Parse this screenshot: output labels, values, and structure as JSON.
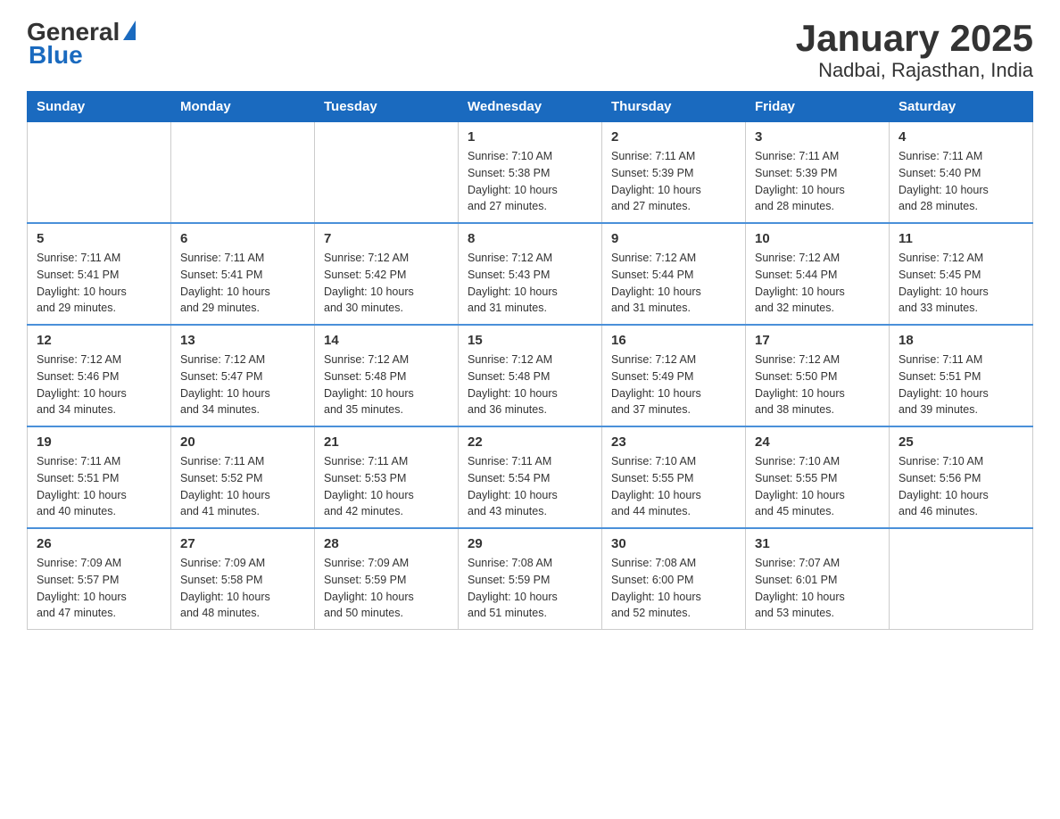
{
  "header": {
    "logo_general": "General",
    "logo_blue": "Blue",
    "title": "January 2025",
    "subtitle": "Nadbai, Rajasthan, India"
  },
  "days_of_week": [
    "Sunday",
    "Monday",
    "Tuesday",
    "Wednesday",
    "Thursday",
    "Friday",
    "Saturday"
  ],
  "weeks": [
    [
      {
        "day": "",
        "info": ""
      },
      {
        "day": "",
        "info": ""
      },
      {
        "day": "",
        "info": ""
      },
      {
        "day": "1",
        "info": "Sunrise: 7:10 AM\nSunset: 5:38 PM\nDaylight: 10 hours\nand 27 minutes."
      },
      {
        "day": "2",
        "info": "Sunrise: 7:11 AM\nSunset: 5:39 PM\nDaylight: 10 hours\nand 27 minutes."
      },
      {
        "day": "3",
        "info": "Sunrise: 7:11 AM\nSunset: 5:39 PM\nDaylight: 10 hours\nand 28 minutes."
      },
      {
        "day": "4",
        "info": "Sunrise: 7:11 AM\nSunset: 5:40 PM\nDaylight: 10 hours\nand 28 minutes."
      }
    ],
    [
      {
        "day": "5",
        "info": "Sunrise: 7:11 AM\nSunset: 5:41 PM\nDaylight: 10 hours\nand 29 minutes."
      },
      {
        "day": "6",
        "info": "Sunrise: 7:11 AM\nSunset: 5:41 PM\nDaylight: 10 hours\nand 29 minutes."
      },
      {
        "day": "7",
        "info": "Sunrise: 7:12 AM\nSunset: 5:42 PM\nDaylight: 10 hours\nand 30 minutes."
      },
      {
        "day": "8",
        "info": "Sunrise: 7:12 AM\nSunset: 5:43 PM\nDaylight: 10 hours\nand 31 minutes."
      },
      {
        "day": "9",
        "info": "Sunrise: 7:12 AM\nSunset: 5:44 PM\nDaylight: 10 hours\nand 31 minutes."
      },
      {
        "day": "10",
        "info": "Sunrise: 7:12 AM\nSunset: 5:44 PM\nDaylight: 10 hours\nand 32 minutes."
      },
      {
        "day": "11",
        "info": "Sunrise: 7:12 AM\nSunset: 5:45 PM\nDaylight: 10 hours\nand 33 minutes."
      }
    ],
    [
      {
        "day": "12",
        "info": "Sunrise: 7:12 AM\nSunset: 5:46 PM\nDaylight: 10 hours\nand 34 minutes."
      },
      {
        "day": "13",
        "info": "Sunrise: 7:12 AM\nSunset: 5:47 PM\nDaylight: 10 hours\nand 34 minutes."
      },
      {
        "day": "14",
        "info": "Sunrise: 7:12 AM\nSunset: 5:48 PM\nDaylight: 10 hours\nand 35 minutes."
      },
      {
        "day": "15",
        "info": "Sunrise: 7:12 AM\nSunset: 5:48 PM\nDaylight: 10 hours\nand 36 minutes."
      },
      {
        "day": "16",
        "info": "Sunrise: 7:12 AM\nSunset: 5:49 PM\nDaylight: 10 hours\nand 37 minutes."
      },
      {
        "day": "17",
        "info": "Sunrise: 7:12 AM\nSunset: 5:50 PM\nDaylight: 10 hours\nand 38 minutes."
      },
      {
        "day": "18",
        "info": "Sunrise: 7:11 AM\nSunset: 5:51 PM\nDaylight: 10 hours\nand 39 minutes."
      }
    ],
    [
      {
        "day": "19",
        "info": "Sunrise: 7:11 AM\nSunset: 5:51 PM\nDaylight: 10 hours\nand 40 minutes."
      },
      {
        "day": "20",
        "info": "Sunrise: 7:11 AM\nSunset: 5:52 PM\nDaylight: 10 hours\nand 41 minutes."
      },
      {
        "day": "21",
        "info": "Sunrise: 7:11 AM\nSunset: 5:53 PM\nDaylight: 10 hours\nand 42 minutes."
      },
      {
        "day": "22",
        "info": "Sunrise: 7:11 AM\nSunset: 5:54 PM\nDaylight: 10 hours\nand 43 minutes."
      },
      {
        "day": "23",
        "info": "Sunrise: 7:10 AM\nSunset: 5:55 PM\nDaylight: 10 hours\nand 44 minutes."
      },
      {
        "day": "24",
        "info": "Sunrise: 7:10 AM\nSunset: 5:55 PM\nDaylight: 10 hours\nand 45 minutes."
      },
      {
        "day": "25",
        "info": "Sunrise: 7:10 AM\nSunset: 5:56 PM\nDaylight: 10 hours\nand 46 minutes."
      }
    ],
    [
      {
        "day": "26",
        "info": "Sunrise: 7:09 AM\nSunset: 5:57 PM\nDaylight: 10 hours\nand 47 minutes."
      },
      {
        "day": "27",
        "info": "Sunrise: 7:09 AM\nSunset: 5:58 PM\nDaylight: 10 hours\nand 48 minutes."
      },
      {
        "day": "28",
        "info": "Sunrise: 7:09 AM\nSunset: 5:59 PM\nDaylight: 10 hours\nand 50 minutes."
      },
      {
        "day": "29",
        "info": "Sunrise: 7:08 AM\nSunset: 5:59 PM\nDaylight: 10 hours\nand 51 minutes."
      },
      {
        "day": "30",
        "info": "Sunrise: 7:08 AM\nSunset: 6:00 PM\nDaylight: 10 hours\nand 52 minutes."
      },
      {
        "day": "31",
        "info": "Sunrise: 7:07 AM\nSunset: 6:01 PM\nDaylight: 10 hours\nand 53 minutes."
      },
      {
        "day": "",
        "info": ""
      }
    ]
  ]
}
